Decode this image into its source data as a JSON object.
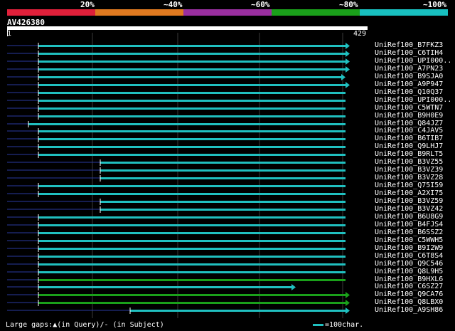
{
  "legend": {
    "colors": [
      "#e0203a",
      "#e07a20",
      "#9a2fa0",
      "#1aa01a",
      "#18c0c0"
    ],
    "labels": [
      "20%",
      "~40%",
      "~60%",
      "~80%",
      "~100%"
    ]
  },
  "query": {
    "id": "AV426380",
    "start": "1",
    "end": "429"
  },
  "hits": [
    {
      "label": "UniRef100_B7FKZ3",
      "color": "#20c0c0",
      "start": 44,
      "end": 476,
      "left_arrow": false,
      "right_arrow": true
    },
    {
      "label": "UniRef100_C6TIH4",
      "color": "#20c0c0",
      "start": 44,
      "end": 476,
      "left_arrow": false,
      "right_arrow": true
    },
    {
      "label": "UniRef100_UPI000..",
      "color": "#20c0c0",
      "start": 44,
      "end": 476,
      "left_arrow": false,
      "right_arrow": true
    },
    {
      "label": "UniRef100_A7PN23",
      "color": "#20c0c0",
      "start": 44,
      "end": 476,
      "left_arrow": false,
      "right_arrow": true
    },
    {
      "label": "UniRef100_B9SJA0",
      "color": "#20c0c0",
      "start": 44,
      "end": 470,
      "left_arrow": false,
      "right_arrow": true
    },
    {
      "label": "UniRef100_A9P947",
      "color": "#20c0c0",
      "start": 44,
      "end": 476,
      "left_arrow": false,
      "right_arrow": true
    },
    {
      "label": "UniRef100_Q10Q37",
      "color": "#20c0c0",
      "start": 44,
      "end": 476,
      "left_arrow": false,
      "right_arrow": false
    },
    {
      "label": "UniRef100_UPI000..",
      "color": "#20c0c0",
      "start": 44,
      "end": 476,
      "left_arrow": false,
      "right_arrow": false
    },
    {
      "label": "UniRef100_C5WTN7",
      "color": "#20c0c0",
      "start": 44,
      "end": 476,
      "left_arrow": false,
      "right_arrow": false
    },
    {
      "label": "UniRef100_B9H0E9",
      "color": "#20c0c0",
      "start": 44,
      "end": 476,
      "left_arrow": false,
      "right_arrow": false
    },
    {
      "label": "UniRef100_Q84JZ7",
      "color": "#20c0c0",
      "start": 30,
      "end": 476,
      "left_arrow": false,
      "right_arrow": false
    },
    {
      "label": "UniRef100_C4JAV5",
      "color": "#20c0c0",
      "start": 44,
      "end": 476,
      "left_arrow": false,
      "right_arrow": false
    },
    {
      "label": "UniRef100_B6TIB7",
      "color": "#20c0c0",
      "start": 44,
      "end": 476,
      "left_arrow": false,
      "right_arrow": false
    },
    {
      "label": "UniRef100_Q9LHJ7",
      "color": "#20c0c0",
      "start": 44,
      "end": 476,
      "left_arrow": false,
      "right_arrow": false
    },
    {
      "label": "UniRef100_B9RLT5",
      "color": "#20c0c0",
      "start": 44,
      "end": 476,
      "left_arrow": false,
      "right_arrow": false
    },
    {
      "label": "UniRef100_B3VZ55",
      "color": "#20c0c0",
      "start": 131,
      "end": 476,
      "left_arrow": false,
      "right_arrow": false
    },
    {
      "label": "UniRef100_B3VZ39",
      "color": "#20c0c0",
      "start": 131,
      "end": 476,
      "left_arrow": false,
      "right_arrow": false
    },
    {
      "label": "UniRef100_B3VZ28",
      "color": "#20c0c0",
      "start": 131,
      "end": 476,
      "left_arrow": false,
      "right_arrow": false
    },
    {
      "label": "UniRef100_Q75I59",
      "color": "#20c0c0",
      "start": 44,
      "end": 476,
      "left_arrow": false,
      "right_arrow": false
    },
    {
      "label": "UniRef100_A2XI75",
      "color": "#20c0c0",
      "start": 44,
      "end": 476,
      "left_arrow": false,
      "right_arrow": false
    },
    {
      "label": "UniRef100_B3VZ59",
      "color": "#20c0c0",
      "start": 131,
      "end": 476,
      "left_arrow": false,
      "right_arrow": false
    },
    {
      "label": "UniRef100_B3VZ42",
      "color": "#20c0c0",
      "start": 131,
      "end": 476,
      "left_arrow": false,
      "right_arrow": false
    },
    {
      "label": "UniRef100_B6U8G9",
      "color": "#20c0c0",
      "start": 44,
      "end": 476,
      "left_arrow": false,
      "right_arrow": false
    },
    {
      "label": "UniRef100_B4FJS4",
      "color": "#20c0c0",
      "start": 44,
      "end": 476,
      "left_arrow": false,
      "right_arrow": false
    },
    {
      "label": "UniRef100_B6SSZ2",
      "color": "#20c0c0",
      "start": 44,
      "end": 476,
      "left_arrow": false,
      "right_arrow": false
    },
    {
      "label": "UniRef100_C5WWH5",
      "color": "#20c0c0",
      "start": 44,
      "end": 476,
      "left_arrow": false,
      "right_arrow": false
    },
    {
      "label": "UniRef100_B9I2W9",
      "color": "#20c0c0",
      "start": 44,
      "end": 476,
      "left_arrow": false,
      "right_arrow": false
    },
    {
      "label": "UniRef100_C6T8S4",
      "color": "#20c0c0",
      "start": 44,
      "end": 476,
      "left_arrow": false,
      "right_arrow": false
    },
    {
      "label": "UniRef100_Q9C546",
      "color": "#20c0c0",
      "start": 44,
      "end": 476,
      "left_arrow": false,
      "right_arrow": false
    },
    {
      "label": "UniRef100_Q8L9H5",
      "color": "#20c0c0",
      "start": 44,
      "end": 476,
      "left_arrow": false,
      "right_arrow": false
    },
    {
      "label": "UniRef100_B9HXL6",
      "color": "#1aa01a",
      "start": 44,
      "end": 476,
      "left_arrow": false,
      "right_arrow": false
    },
    {
      "label": "UniRef100_C6SZ27",
      "color": "#20c0c0",
      "start": 44,
      "end": 400,
      "left_arrow": false,
      "right_arrow": true
    },
    {
      "label": "UniRef100_Q9CA76",
      "color": "#1aa01a",
      "start": 44,
      "end": 476,
      "left_arrow": false,
      "right_arrow": true
    },
    {
      "label": "UniRef100_Q8LBX0",
      "color": "#1aa01a",
      "start": 44,
      "end": 476,
      "left_arrow": false,
      "right_arrow": true
    },
    {
      "label": "UniRef100_A9SH86",
      "color": "#20c0c0",
      "start": 173,
      "end": 476,
      "left_arrow": false,
      "right_arrow": true
    }
  ],
  "footer": {
    "gaps": "Large gaps:▲(in Query)/- (in Subject)",
    "scale": "=100char."
  }
}
